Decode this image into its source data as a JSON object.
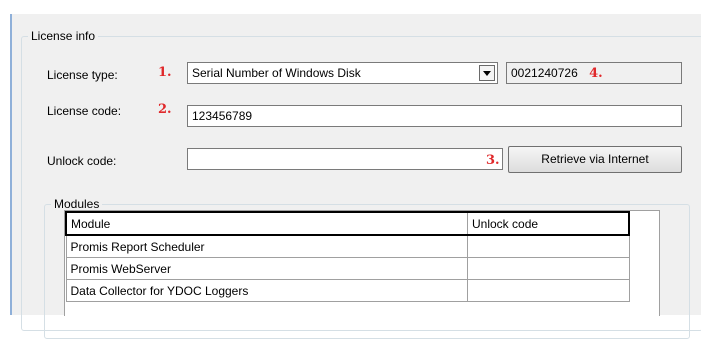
{
  "license_info": {
    "legend": "License info",
    "license_type": {
      "label": "License type:",
      "marker": "1.",
      "value": "Serial Number of Windows Disk"
    },
    "serial": {
      "value": "0021240726",
      "marker": "4."
    },
    "license_code": {
      "label": "License code:",
      "marker": "2.",
      "value": "123456789"
    },
    "unlock_code": {
      "label": "Unlock code:",
      "value": "",
      "marker": "3."
    },
    "retrieve_button": "Retrieve via Internet"
  },
  "modules": {
    "legend": "Modules",
    "columns": [
      "Module",
      "Unlock code"
    ],
    "rows": [
      {
        "module": "Promis Report Scheduler",
        "unlock_code": ""
      },
      {
        "module": "Promis WebServer",
        "unlock_code": ""
      },
      {
        "module": "Data Collector for YDOC Loggers",
        "unlock_code": ""
      }
    ]
  },
  "colors": {
    "marker": "#e0282a",
    "panel_bg": "#f0f0f0",
    "group_border": "#d5dfe5"
  },
  "icons": {
    "dropdown": "chevron-down-icon"
  }
}
